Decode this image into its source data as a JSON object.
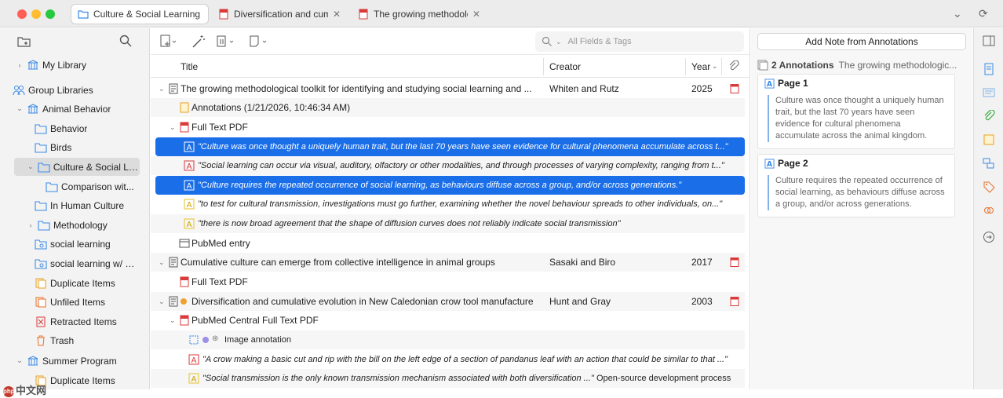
{
  "tabs": [
    {
      "label": "Culture & Social Learning",
      "active": true
    },
    {
      "label": "Diversification and cumu",
      "active": false
    },
    {
      "label": "The growing methodolog",
      "active": false
    }
  ],
  "sidebar": {
    "items": [
      {
        "label": "My Library"
      },
      {
        "label": "Group Libraries"
      },
      {
        "label": "Animal Behavior"
      },
      {
        "label": "Behavior"
      },
      {
        "label": "Birds"
      },
      {
        "label": "Culture & Social Le..."
      },
      {
        "label": "Comparison wit..."
      },
      {
        "label": "In Human Culture"
      },
      {
        "label": "Methodology"
      },
      {
        "label": "social learning"
      },
      {
        "label": "social learning w/ a..."
      },
      {
        "label": "Duplicate Items"
      },
      {
        "label": "Unfiled Items"
      },
      {
        "label": "Retracted Items"
      },
      {
        "label": "Trash"
      },
      {
        "label": "Summer Program"
      },
      {
        "label": "Duplicate Items"
      }
    ]
  },
  "middle": {
    "search_placeholder": "All Fields & Tags",
    "columns": {
      "title": "Title",
      "creator": "Creator",
      "year": "Year"
    },
    "rows": [
      {
        "title": "The growing methodological toolkit for identifying and studying social learning and ...",
        "creator": "Whiten and Rutz",
        "year": "2025"
      },
      {
        "title": "Annotations (1/21/2026, 10:46:34 AM)"
      },
      {
        "title": "Full Text PDF"
      },
      {
        "title": "\"Culture was once thought a uniquely human trait, but the last 70 years have seen evidence for cultural phenomena accumulate across t...\""
      },
      {
        "title": "\"Social learning can occur via visual, auditory, olfactory or other modalities, and through processes of varying complexity, ranging from t...\""
      },
      {
        "title": "\"Culture requires the repeated occurrence of social learning, as behaviours diffuse across a group, and/or across generations.\""
      },
      {
        "title": "\"to test for cultural transmission, investigations must go further, examining whether the novel behaviour spreads to other individuals, on...\""
      },
      {
        "title": "\"there is now broad agreement that the shape of diffusion curves does not reliably indicate social transmission\""
      },
      {
        "title": "PubMed entry"
      },
      {
        "title": "Cumulative culture can emerge from collective intelligence in animal groups",
        "creator": "Sasaki and Biro",
        "year": "2017"
      },
      {
        "title": "Full Text PDF"
      },
      {
        "title": "Diversification and cumulative evolution in New Caledonian crow tool manufacture",
        "creator": "Hunt and Gray",
        "year": "2003"
      },
      {
        "title": "PubMed Central Full Text PDF"
      },
      {
        "title": "Image annotation"
      },
      {
        "title": "\"A crow making a basic cut and rip with the bill on the left edge of a section of pandanus leaf with an action that could be similar to that ...\""
      },
      {
        "title": "\"Social transmission is the only known transmission mechanism associated with both diversification ...\"",
        "extra": "Open-source development process"
      }
    ]
  },
  "right": {
    "add_note": "Add Note from Annotations",
    "ann_count": "2 Annotations",
    "ann_source": "The growing methodologic...",
    "cards": [
      {
        "page": "Page 1",
        "text": "Culture was once thought a uniquely human trait, but the last 70 years have seen evidence for cultural phenomena accumulate across the animal kingdom."
      },
      {
        "page": "Page 2",
        "text": "Culture requires the repeated occurrence of social learning, as behaviours diffuse across a group, and/or across generations."
      }
    ]
  },
  "watermark": "中文网",
  "colors": {
    "selection": "#1a6ee8",
    "folder": "#3b8be6",
    "pdf": "#d93a3a",
    "annotation_yellow": "#e8c227"
  }
}
